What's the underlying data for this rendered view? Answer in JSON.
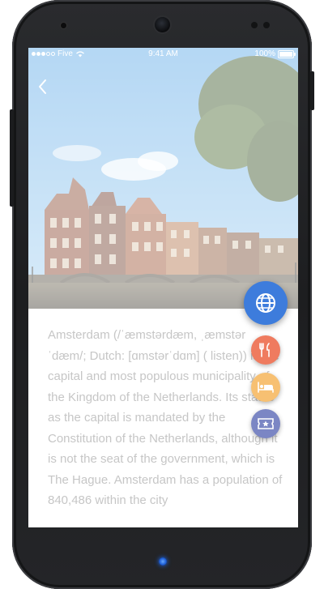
{
  "status_bar": {
    "carrier": "Five",
    "time": "9:41 AM",
    "battery": "100%"
  },
  "hero": {
    "city_image": "amsterdam-canal-houses-photo"
  },
  "article": {
    "text": "Amsterdam (/ˈæmstərdæm, ˌæmstərˈdæm/; Dutch: [ɑmstərˈdɑm] ( listen)) is the capital and most populous municipality of the Kingdom of the Netherlands. Its status as the capital is mandated by the Constitution of the Netherlands, although it is not the seat of the government, which is The Hague. Amsterdam has a population of 840,486 within the city"
  },
  "fab_menu": {
    "main_icon": "globe-icon",
    "items": [
      {
        "icon": "restaurant-icon",
        "color": "#ef7b5f"
      },
      {
        "icon": "hotel-bed-icon",
        "color": "#f7c072"
      },
      {
        "icon": "ticket-icon",
        "color": "#7b86c4"
      }
    ],
    "main_color": "#3d7cdc"
  }
}
